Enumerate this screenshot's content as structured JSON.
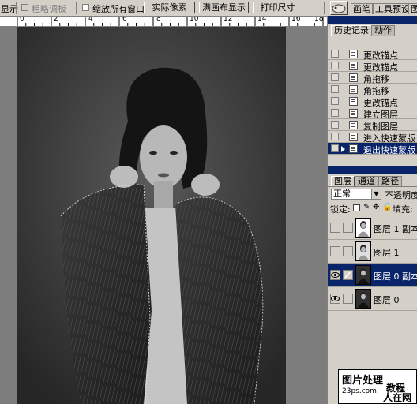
{
  "options_bar": {
    "clipped_label": "显示",
    "coarse_label": "粗略调板",
    "resize_windows_label": "缩放所有窗口",
    "actual_pixels_label": "实际像素",
    "fit_screen_label": "满画布显示",
    "print_size_label": "打印尺寸"
  },
  "palette_well": {
    "tabs": [
      "画笔",
      "工具预设",
      "图"
    ]
  },
  "ruler": {
    "numbers": [
      "0",
      "2",
      "4",
      "6",
      "8",
      "10",
      "12",
      "14",
      "16",
      "18"
    ]
  },
  "history_panel": {
    "tabs": [
      "历史记录",
      "动作"
    ],
    "items": [
      {
        "label": "更改锚点"
      },
      {
        "label": "更改锚点"
      },
      {
        "label": "角拖移"
      },
      {
        "label": "角拖移"
      },
      {
        "label": "更改锚点"
      },
      {
        "label": "建立图层"
      },
      {
        "label": "复制图层"
      },
      {
        "label": "进入快速蒙版"
      },
      {
        "label": "退出快速蒙版"
      }
    ]
  },
  "layers_panel": {
    "tabs": [
      "图层",
      "通道",
      "路径"
    ],
    "blend_mode": "正常",
    "opacity_label": "不透明度:",
    "lock_label": "锁定:",
    "fill_label": "填充:",
    "layers": [
      {
        "name": "图层 1 副本",
        "visible": false
      },
      {
        "name": "图层 1",
        "visible": false
      },
      {
        "name": "图层 0 副本",
        "visible": true
      },
      {
        "name": "图层 0",
        "visible": true
      }
    ]
  },
  "watermark": {
    "line1": "图片处理",
    "line2": "教程",
    "line3": "23ps.com",
    "line4": "人在网"
  },
  "colors": {
    "selection_blue": "#0a246a",
    "panel_gray": "#d4d0c8",
    "canvas_gray": "#7d7d7d"
  }
}
